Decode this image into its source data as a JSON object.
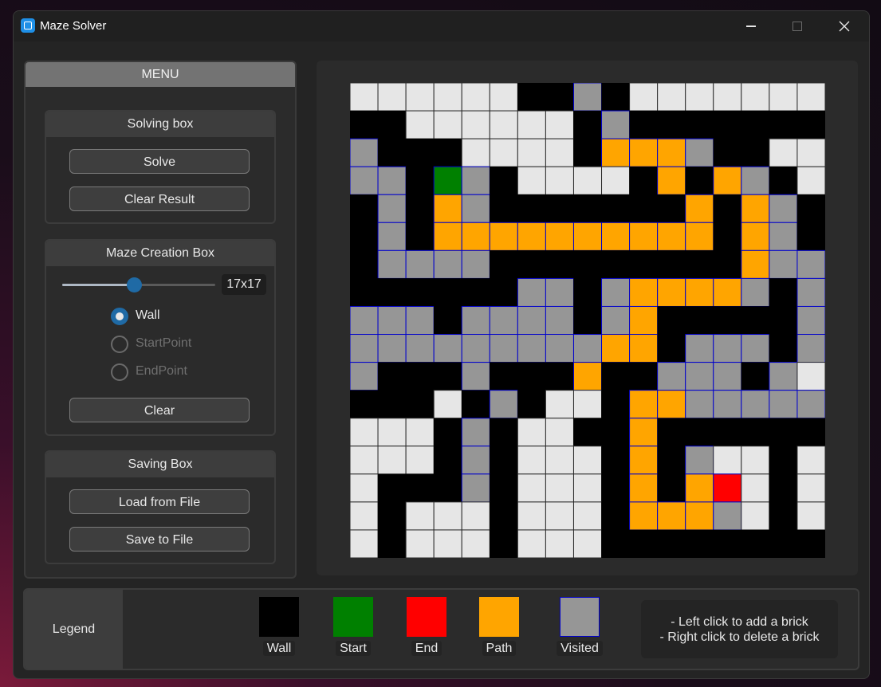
{
  "window": {
    "title": "Maze Solver"
  },
  "menu": {
    "header": "MENU",
    "solving_box": {
      "title": "Solving box",
      "solve_label": "Solve",
      "clear_result_label": "Clear Result"
    },
    "maze_creation_box": {
      "title": "Maze Creation Box",
      "size_value": "17x17",
      "slider_fraction": 0.47,
      "options": [
        "Wall",
        "StartPoint",
        "EndPoint"
      ],
      "selected_option": "Wall",
      "clear_label": "Clear"
    },
    "saving_box": {
      "title": "Saving Box",
      "load_label": "Load from File",
      "save_label": "Save to File"
    }
  },
  "maze": {
    "rows": 17,
    "cols": 17,
    "cell_codes": {
      "#": "wall",
      ".": "empty",
      "V": "visited",
      "P": "path",
      "S": "start",
      "E": "end"
    },
    "grid": [
      "......##V#.......",
      "##......#V#######",
      "V###....#PPPV##.",
      "VV#SV#....#P#PV#.",
      "#V#PV#######P#PV#.",
      "#V#PPPPPPPPPP#PV##",
      "#VVVV#########PVVV",
      "######VV#VPPPPV#V",
      "VVV#VVVV#VP#####V",
      "VVVVVVVVVPP#VVV#V",
      "V###V###P##VVV#V",
      "###.#V#..#PPVVVVVV",
      "...#V#..##P######",
      "...#V#...#P#V..#.",
      ".###V#...#P#PE.#.",
      ".#...#...#PPPV.#.",
      ".#...#...########."
    ],
    "colors": {
      "wall": "#000000",
      "empty": "#e6e6e6",
      "visited": "#969696",
      "path": "#ffa500",
      "start": "#008000",
      "end": "#ff0000",
      "cell_border": "#0000cc"
    }
  },
  "legend": {
    "title": "Legend",
    "items": [
      {
        "label": "Wall",
        "color": "#000000"
      },
      {
        "label": "Start",
        "color": "#008000"
      },
      {
        "label": "End",
        "color": "#ff0000"
      },
      {
        "label": "Path",
        "color": "#ffa500"
      },
      {
        "label": "Visited",
        "color": "#969696"
      }
    ],
    "instructions": [
      "- Left click to add a brick",
      "- Right click to delete a brick"
    ]
  }
}
